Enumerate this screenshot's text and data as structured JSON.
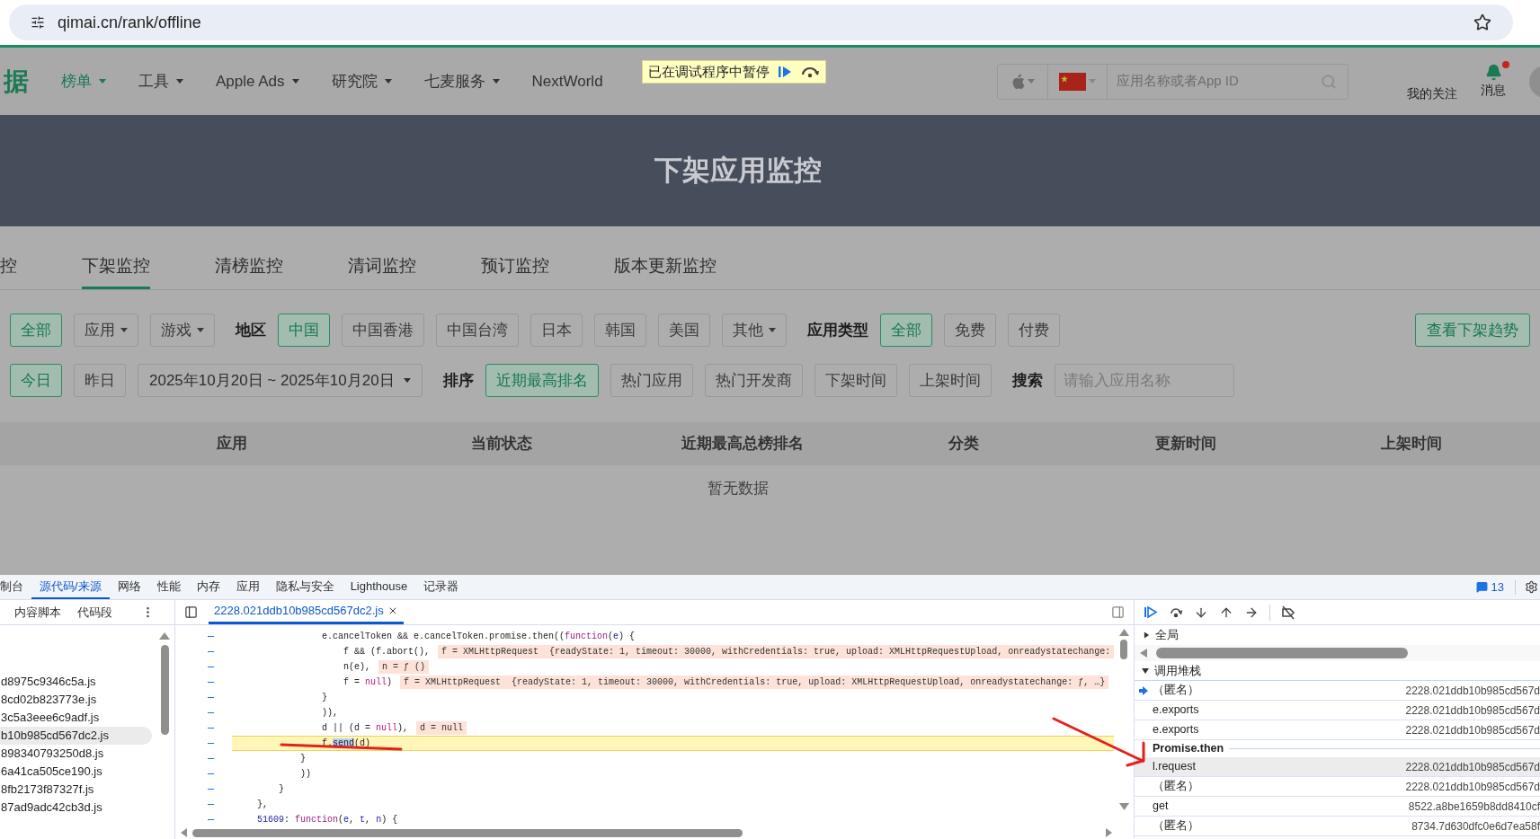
{
  "browser": {
    "url": "qimai.cn/rank/offline"
  },
  "nav": {
    "logo": "据",
    "items": [
      {
        "label": "榜单",
        "selected": true,
        "dropdown": true
      },
      {
        "label": "工具",
        "selected": false,
        "dropdown": true
      },
      {
        "label": "Apple Ads",
        "selected": false,
        "dropdown": true
      },
      {
        "label": "研究院",
        "selected": false,
        "dropdown": true
      },
      {
        "label": "七麦服务",
        "selected": false,
        "dropdown": true
      },
      {
        "label": "NextWorld",
        "selected": false,
        "dropdown": false
      }
    ],
    "debug_banner": {
      "text": "已在调试程序中暂停"
    },
    "store_search": {
      "placeholder": "应用名称或者App ID"
    },
    "follow_label": "我的关注",
    "messages": {
      "label": "消息",
      "unread": true
    }
  },
  "hero": {
    "title": "下架应用监控"
  },
  "tabs": [
    {
      "label": "控",
      "selected": false
    },
    {
      "label": "下架监控",
      "selected": true
    },
    {
      "label": "清榜监控",
      "selected": false
    },
    {
      "label": "清词监控",
      "selected": false
    },
    {
      "label": "预订监控",
      "selected": false
    },
    {
      "label": "版本更新监控",
      "selected": false
    }
  ],
  "filters": {
    "row_1": [
      {
        "kind": "chip",
        "label": "全部",
        "selected": true
      },
      {
        "kind": "dropdown",
        "label": "应用",
        "selected": false
      },
      {
        "kind": "dropdown",
        "label": "游戏",
        "selected": false
      },
      {
        "kind": "label",
        "label": "地区"
      },
      {
        "kind": "chip",
        "label": "中国",
        "selected": true
      },
      {
        "kind": "chip",
        "label": "中国香港",
        "selected": false
      },
      {
        "kind": "chip",
        "label": "中国台湾",
        "selected": false
      },
      {
        "kind": "chip",
        "label": "日本",
        "selected": false
      },
      {
        "kind": "chip",
        "label": "韩国",
        "selected": false
      },
      {
        "kind": "chip",
        "label": "美国",
        "selected": false
      },
      {
        "kind": "dropdown",
        "label": "其他",
        "selected": false
      },
      {
        "kind": "label",
        "label": "应用类型"
      },
      {
        "kind": "chip",
        "label": "全部",
        "selected": true
      },
      {
        "kind": "chip",
        "label": "免费",
        "selected": false
      },
      {
        "kind": "chip",
        "label": "付费",
        "selected": false
      },
      {
        "kind": "action",
        "label": "查看下架趋势"
      }
    ],
    "row_2": [
      {
        "kind": "chip",
        "label": "今日",
        "selected": true
      },
      {
        "kind": "chip",
        "label": "昨日",
        "selected": false
      },
      {
        "kind": "date",
        "label": "2025年10月20日 ~ 2025年10月20日"
      },
      {
        "kind": "label",
        "label": "排序"
      },
      {
        "kind": "chip",
        "label": "近期最高排名",
        "selected": true
      },
      {
        "kind": "chip",
        "label": "热门应用",
        "selected": false
      },
      {
        "kind": "chip",
        "label": "热门开发商",
        "selected": false
      },
      {
        "kind": "chip",
        "label": "下架时间",
        "selected": false
      },
      {
        "kind": "chip",
        "label": "上架时间",
        "selected": false
      },
      {
        "kind": "label",
        "label": "搜索"
      },
      {
        "kind": "search",
        "placeholder": "请输入应用名称"
      }
    ]
  },
  "table": {
    "columns": [
      "应用",
      "当前状态",
      "近期最高总榜排名",
      "分类",
      "更新时间",
      "上架时间"
    ],
    "empty_text": "暂无数据"
  },
  "devtools": {
    "tabs": [
      {
        "label": "制台",
        "selected": false
      },
      {
        "label": "源代码/来源",
        "selected": true
      },
      {
        "label": "网络",
        "selected": false
      },
      {
        "label": "性能",
        "selected": false
      },
      {
        "label": "内存",
        "selected": false
      },
      {
        "label": "应用",
        "selected": false
      },
      {
        "label": "隐私与安全",
        "selected": false
      },
      {
        "label": "Lighthouse",
        "selected": false
      },
      {
        "label": "记录器",
        "selected": false
      }
    ],
    "issues_count": "13",
    "navigator_tabs": [
      "内容脚本",
      "代码段"
    ],
    "files": [
      {
        "name": "d8975c9346c5a.js",
        "selected": false
      },
      {
        "name": "8cd02b823773e.js",
        "selected": false
      },
      {
        "name": "3c5a3eee6c9adf.js",
        "selected": false
      },
      {
        "name": "b10b985cd567dc2.js",
        "selected": true
      },
      {
        "name": "898340793250d8.js",
        "selected": false
      },
      {
        "name": "6a41ca505ce190.js",
        "selected": false
      },
      {
        "name": "8fb2173f87327f.js",
        "selected": false
      },
      {
        "name": "87ad9adc42cb3d.js",
        "selected": false
      }
    ],
    "editor_tab": "2228.021ddb10b985cd567dc2.js",
    "code_lines": [
      {
        "paused": false,
        "segments": [
          {
            "kind": "plain",
            "text": "            e.cancelToken && e.cancelToken.promise.then(("
          },
          {
            "kind": "keyword",
            "text": "function"
          },
          {
            "kind": "plain",
            "text": "("
          },
          {
            "kind": "param",
            "text": "e"
          },
          {
            "kind": "plain",
            "text": ") {"
          }
        ]
      },
      {
        "paused": false,
        "segments": [
          {
            "kind": "plain",
            "text": "                f && (f.abort(),"
          },
          {
            "kind": "hint",
            "text": "f = XMLHttpRequest  {readyState: 1, timeout: 30000, withCredentials: true, upload: XMLHttpRequestUpload, onreadystatechange:"
          }
        ]
      },
      {
        "paused": false,
        "segments": [
          {
            "kind": "plain",
            "text": "                n(e),"
          },
          {
            "kind": "hint",
            "text": "n = ƒ ()"
          }
        ]
      },
      {
        "paused": false,
        "segments": [
          {
            "kind": "plain",
            "text": "                f = "
          },
          {
            "kind": "literal",
            "text": "null"
          },
          {
            "kind": "plain",
            "text": ")"
          },
          {
            "kind": "hint",
            "text": "f = XMLHttpRequest  {readyState: 1, timeout: 30000, withCredentials: true, upload: XMLHttpRequestUpload, onreadystatechange: ƒ, …}"
          }
        ]
      },
      {
        "paused": false,
        "segments": [
          {
            "kind": "plain",
            "text": "            }"
          }
        ]
      },
      {
        "paused": false,
        "segments": [
          {
            "kind": "plain",
            "text": "            )),"
          }
        ]
      },
      {
        "paused": false,
        "segments": [
          {
            "kind": "plain",
            "text": "            d || (d = "
          },
          {
            "kind": "literal",
            "text": "null"
          },
          {
            "kind": "plain",
            "text": "),"
          },
          {
            "kind": "hint",
            "text": "d = null"
          }
        ]
      },
      {
        "paused": true,
        "segments": [
          {
            "kind": "plain",
            "text": "            f."
          },
          {
            "kind": "selected",
            "text": "send"
          },
          {
            "kind": "plain",
            "text": "(d)"
          }
        ]
      },
      {
        "paused": false,
        "segments": [
          {
            "kind": "plain",
            "text": "        }"
          }
        ]
      },
      {
        "paused": false,
        "segments": [
          {
            "kind": "plain",
            "text": "        ))"
          }
        ]
      },
      {
        "paused": false,
        "segments": [
          {
            "kind": "plain",
            "text": "    }"
          }
        ]
      },
      {
        "paused": false,
        "segments": [
          {
            "kind": "plain",
            "text": "},"
          }
        ]
      },
      {
        "paused": false,
        "segments": [
          {
            "kind": "number",
            "text": "51609"
          },
          {
            "kind": "plain",
            "text": ": "
          },
          {
            "kind": "keyword",
            "text": "function"
          },
          {
            "kind": "plain",
            "text": "("
          },
          {
            "kind": "param",
            "text": "e"
          },
          {
            "kind": "plain",
            "text": ", "
          },
          {
            "kind": "param",
            "text": "t"
          },
          {
            "kind": "plain",
            "text": ", "
          },
          {
            "kind": "param",
            "text": "n"
          },
          {
            "kind": "plain",
            "text": ") {"
          }
        ]
      }
    ],
    "scope": {
      "label": "全局",
      "expanded": false
    },
    "call_stack": {
      "label": "调用堆栈",
      "expanded": true,
      "frames": [
        {
          "kind": "frame",
          "name": "（匿名）",
          "location": "2228.021ddb10b985cd567d",
          "current": true,
          "selected": false
        },
        {
          "kind": "frame",
          "name": "e.exports",
          "location": "2228.021ddb10b985cd567d",
          "current": false,
          "selected": false
        },
        {
          "kind": "frame",
          "name": "e.exports",
          "location": "2228.021ddb10b985cd567d",
          "current": false,
          "selected": false
        },
        {
          "kind": "separator",
          "name": "Promise.then"
        },
        {
          "kind": "frame",
          "name": "l.request",
          "location": "2228.021ddb10b985cd567d",
          "current": false,
          "selected": true
        },
        {
          "kind": "frame",
          "name": "（匿名）",
          "location": "2228.021ddb10b985cd567d",
          "current": false,
          "selected": false
        },
        {
          "kind": "frame",
          "name": "get",
          "location": "8522.a8be1659b8dd8410cf",
          "current": false,
          "selected": false
        },
        {
          "kind": "frame",
          "name": "（匿名）",
          "location": "8734.7d630dfc0e6d7ea58f",
          "current": false,
          "selected": false
        }
      ]
    }
  }
}
